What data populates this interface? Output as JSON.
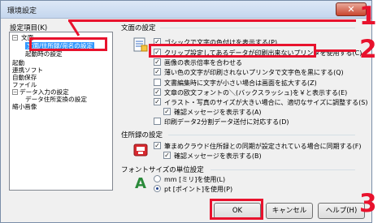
{
  "window": {
    "title": "環境設定",
    "close_glyph": "✕"
  },
  "sidebar": {
    "label": "設定項目(K)",
    "items": [
      {
        "label": "文面"
      },
      {
        "label": "文面/住所録/宛名の設定"
      },
      {
        "label": "起動時の設定"
      },
      {
        "label": "起動"
      },
      {
        "label": "連携ソフト"
      },
      {
        "label": "自動保存"
      },
      {
        "label": "ファイル"
      },
      {
        "label": "データ入力の設定"
      },
      {
        "label": "データ住所変換の設定"
      },
      {
        "label": "縮小画像"
      }
    ]
  },
  "sections": {
    "bunmen": {
      "title": "文面の設定",
      "options": [
        {
          "label": "ゴシックで文字の色付けを表示する(P)",
          "checked": true
        },
        {
          "label": "クリップ設定してあるデータが印刷出来ないプリンタを使用する(C)",
          "checked": true
        },
        {
          "label": "画像の表示倍率を合わせる",
          "checked": true
        },
        {
          "label": "薄い色の文字が印刷されないプリンタで文字色を黒にする(Q)",
          "checked": true
        },
        {
          "label": "文書編集時に文字が小さい場合は画面を拡大する(Z)",
          "checked": false
        },
        {
          "label": "文章の欧文フォントの＼(バックスラッシュ)を￥と表示する(E)",
          "checked": true
        },
        {
          "label": "イラスト・写真のサイズが大きい場合に、適切なサイズに調整する(S)",
          "checked": true
        },
        {
          "label": "確認メッセージを表示する(A)",
          "checked": true
        },
        {
          "label": "印刷データ2分割データ送付に対応する(D)",
          "checked": false
        }
      ]
    },
    "jushoroku": {
      "title": "住所録の設定",
      "options": [
        {
          "label": "筆まめクラウド住所録との同期が設定されている場合に同期する(F)",
          "checked": true
        },
        {
          "label": "確認メッセージを表示する(B)",
          "checked": true
        }
      ]
    },
    "font": {
      "title": "フォントサイズの単位設定",
      "radios": [
        {
          "label": "mm [ミリ]を使用(L)",
          "selected": false
        },
        {
          "label": "pt [ポイント]を使用(P)",
          "selected": true
        }
      ]
    }
  },
  "buttons": {
    "ok": "OK",
    "cancel": "キャンセル",
    "help": "ヘルプ(H)"
  },
  "callouts": [
    "1",
    "2",
    "3"
  ],
  "colors": {
    "callout": "#e8122d",
    "selection": "#3399ff"
  }
}
